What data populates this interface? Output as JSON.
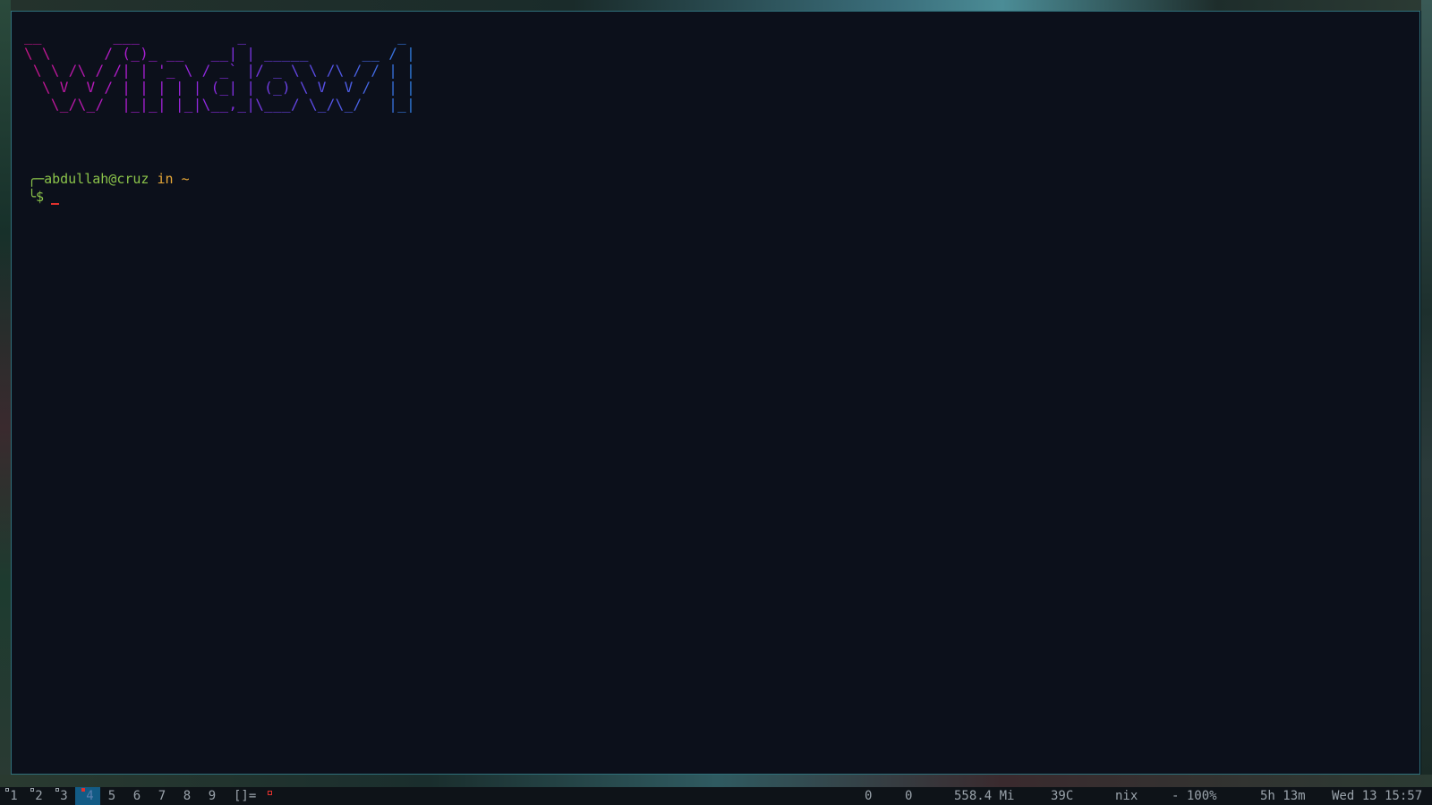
{
  "terminal": {
    "banner_lines": [
      "__        ___           _                 _",
      "\\ \\      / (_)_ __   __| | _____      __ / |",
      " \\ \\ /\\ / /| | '_ \\ / _` |/ _ \\ \\ /\\ / / | |",
      "  \\ V  V / | | | | | (_| | (_) \\ V  V /  | |",
      "   \\_/\\_/  |_|_| |_|\\__,_|\\___/ \\_/\\_/   |_|"
    ],
    "prompt_line1_prefix": "╭─",
    "user_host": "abdullah@cruz",
    "in_word": " in ",
    "cwd": "~",
    "prompt_line2_prefix": "╰",
    "prompt_symbol": "$"
  },
  "statusbar": {
    "workspaces": [
      {
        "label": "1",
        "occupied": true,
        "active": false
      },
      {
        "label": "2",
        "occupied": true,
        "active": false
      },
      {
        "label": "3",
        "occupied": true,
        "active": false
      },
      {
        "label": "4",
        "occupied": true,
        "active": true
      },
      {
        "label": "5",
        "occupied": false,
        "active": false
      },
      {
        "label": "6",
        "occupied": false,
        "active": false
      },
      {
        "label": "7",
        "occupied": false,
        "active": false
      },
      {
        "label": "8",
        "occupied": false,
        "active": false
      },
      {
        "label": "9",
        "occupied": false,
        "active": false
      }
    ],
    "layout_symbol": "[]=",
    "net_down": "0",
    "net_up": "0",
    "memory": "558.4 Mi",
    "temperature": "39C",
    "hostname": "nix",
    "battery": "- 100%",
    "uptime": "5h 13m",
    "datetime": "Wed 13 15:57"
  },
  "colors": {
    "terminal_bg": "#0c101b",
    "border": "#2f6f7a",
    "prompt_green": "#8bc34a",
    "prompt_orange": "#e8a838",
    "cursor_red": "#e0312d",
    "active_ws_bg": "#135b85"
  }
}
